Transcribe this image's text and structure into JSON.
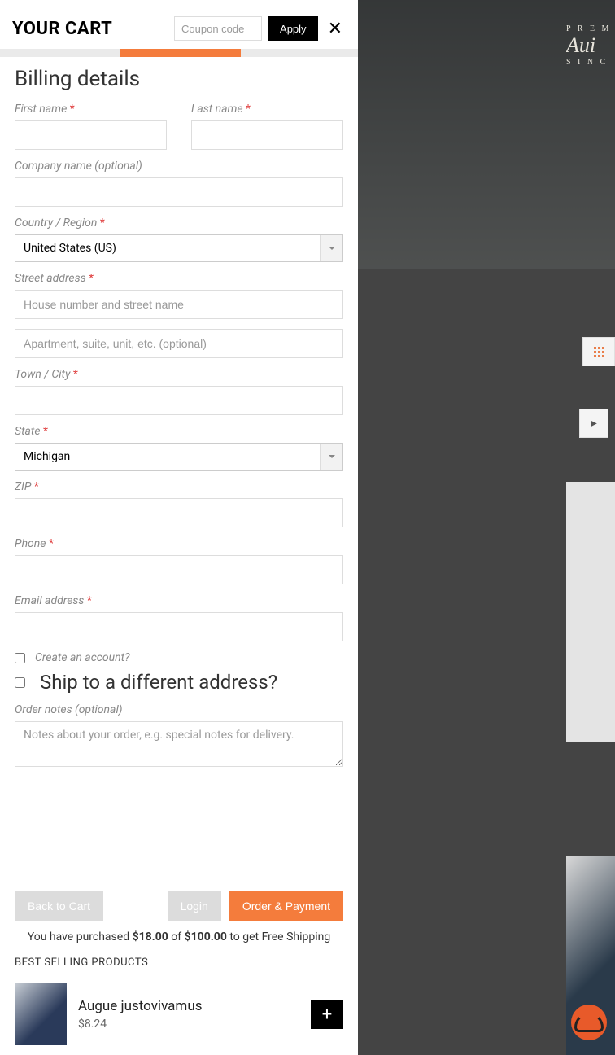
{
  "header": {
    "title": "YOUR CART",
    "coupon_placeholder": "Coupon code",
    "apply_label": "Apply"
  },
  "billing": {
    "title": "Billing details",
    "first_name_label": "First name",
    "last_name_label": "Last name",
    "company_label": "Company name (optional)",
    "country_label": "Country / Region",
    "country_value": "United States (US)",
    "street_label": "Street address",
    "street1_placeholder": "House number and street name",
    "street2_placeholder": "Apartment, suite, unit, etc. (optional)",
    "city_label": "Town / City",
    "state_label": "State",
    "state_value": "Michigan",
    "zip_label": "ZIP",
    "phone_label": "Phone",
    "email_label": "Email address",
    "create_account_label": "Create an account?",
    "ship_diff_label": "Ship to a different address?",
    "order_notes_label": "Order notes (optional)",
    "order_notes_placeholder": "Notes about your order, e.g. special notes for delivery."
  },
  "footer": {
    "back_label": "Back to Cart",
    "login_label": "Login",
    "order_label": "Order & Payment",
    "ship_msg_prefix": "You have purchased ",
    "ship_msg_amount": "$18.00",
    "ship_msg_of": " of ",
    "ship_msg_total": "$100.00",
    "ship_msg_suffix": " to get Free Shipping"
  },
  "bestselling": {
    "title": "BEST SELLING PRODUCTS",
    "product_name": "Augue justovivamus",
    "product_price": "$8.24"
  },
  "backdrop": {
    "logo_top": "P R E M",
    "logo_mid": "Aui",
    "logo_bot": "S I N C"
  }
}
